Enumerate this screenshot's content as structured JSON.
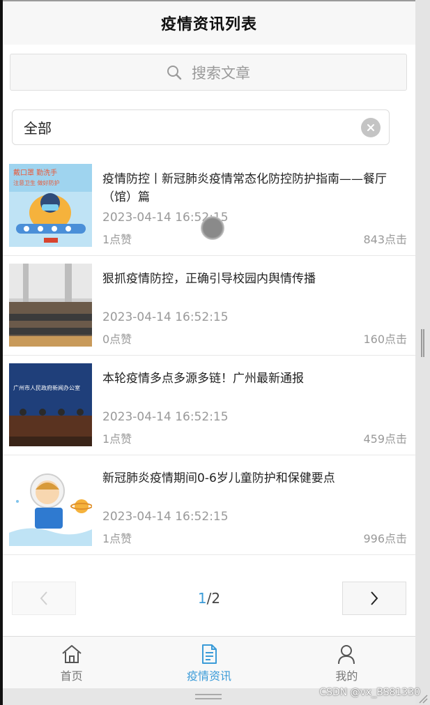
{
  "header": {
    "title": "疫情资讯列表"
  },
  "search": {
    "placeholder": "搜索文章"
  },
  "filter": {
    "value": "全部"
  },
  "articles": [
    {
      "title": "疫情防控丨新冠肺炎疫情常态化防控防护指南——餐厅（馆）篇",
      "date": "2023-04-14 16:52:15",
      "likes": "1点赞",
      "clicks": "843点击",
      "thumb_text": [
        "戴口罩 勤洗手",
        "注意卫生 做好防护"
      ]
    },
    {
      "title": "狠抓疫情防控，正确引导校园内舆情传播",
      "date": "2023-04-14 16:52:15",
      "likes": "0点赞",
      "clicks": "160点击"
    },
    {
      "title": "本轮疫情多点多源多链！广州最新通报",
      "date": "2023-04-14 16:52:15",
      "likes": "1点赞",
      "clicks": "459点击",
      "thumb_text": [
        "广州市人民政府新闻办公室"
      ]
    },
    {
      "title": "新冠肺炎疫情期间0-6岁儿童防护和保健要点",
      "date": "2023-04-14 16:52:15",
      "likes": "1点赞",
      "clicks": "996点击"
    }
  ],
  "pagination": {
    "current": "1",
    "separator": "/",
    "total": "2"
  },
  "tabbar": [
    {
      "label": "首页",
      "icon": "home-icon"
    },
    {
      "label": "疫情资讯",
      "icon": "document-icon",
      "active": true
    },
    {
      "label": "我的",
      "icon": "user-icon"
    }
  ],
  "watermark": "CSDN @vx_BS81330",
  "colors": {
    "accent": "#3a9bd8",
    "muted_text": "#999999",
    "header_bg": "#f7f7f7"
  }
}
